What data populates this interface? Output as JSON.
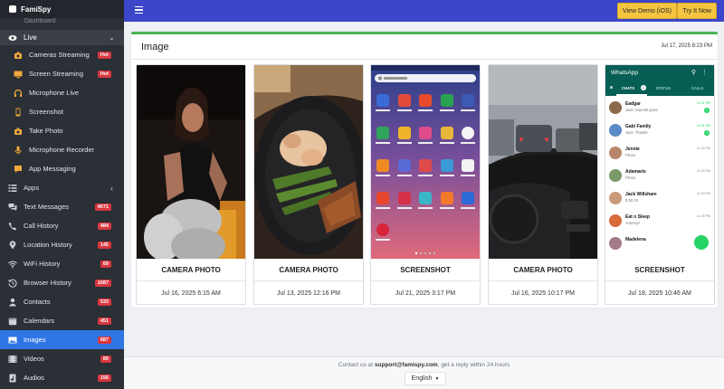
{
  "app": {
    "brand": "FamiSpy"
  },
  "sidebar": {
    "partial_label": "Dashboard",
    "live_group": "Live",
    "live_items": [
      {
        "label": "Cameras Streaming",
        "badge": "Hot"
      },
      {
        "label": "Screen Streaming",
        "badge": "Hot"
      },
      {
        "label": "Microphone Live",
        "badge": ""
      },
      {
        "label": "Screenshot",
        "badge": ""
      },
      {
        "label": "Take Photo",
        "badge": ""
      },
      {
        "label": "Microphone Recorder",
        "badge": ""
      },
      {
        "label": "App Messaging",
        "badge": ""
      }
    ],
    "apps_label": "Apps",
    "items": [
      {
        "label": "Text Messages",
        "badge": "4071"
      },
      {
        "label": "Call History",
        "badge": "484"
      },
      {
        "label": "Location History",
        "badge": "145"
      },
      {
        "label": "WiFi History",
        "badge": "69"
      },
      {
        "label": "Browser History",
        "badge": "1087"
      },
      {
        "label": "Contacts",
        "badge": "533"
      },
      {
        "label": "Calendars",
        "badge": "451"
      },
      {
        "label": "Images",
        "badge": "687"
      },
      {
        "label": "Videos",
        "badge": "89"
      },
      {
        "label": "Audios",
        "badge": "156"
      }
    ]
  },
  "topbar": {
    "view_demo": "View Demo (iOS)",
    "try_now": "Try It Now"
  },
  "card": {
    "title": "Image",
    "date": "Jul 17, 2025 8:23 PM",
    "tiles": [
      {
        "caption": "CAMERA PHOTO",
        "date": "Jul 16, 2025 6:15 AM"
      },
      {
        "caption": "CAMERA PHOTO",
        "date": "Jul 13, 2025 12:16 PM"
      },
      {
        "caption": "SCREENSHOT",
        "date": "Jul 21, 2025 3:17 PM"
      },
      {
        "caption": "CAMERA PHOTO",
        "date": "Jul 16, 2025 10:17 PM"
      },
      {
        "caption": "SCREENSHOT",
        "date": "Jul 18, 2025 10:46 AM"
      }
    ]
  },
  "phone_screenshot": {
    "search": "Search phone",
    "apps": [
      "Samsung",
      "Google",
      "Microsoft Apps",
      "Play Store",
      "Facebook",
      "Phone",
      "Messages",
      "Camera",
      "Gallery",
      "Clock",
      "Contacts",
      "Settings",
      "Calendar",
      "Calculator",
      "Radio",
      "Samsung Notes",
      "Opera Max",
      "USB Backup",
      "UC Browser",
      "Imo",
      "MyJio"
    ]
  },
  "whatsapp": {
    "title": "WhatsApp",
    "tabs": [
      "CHATS",
      "STATUS",
      "CALLS"
    ],
    "chats": [
      {
        "name": "Eadgar",
        "msg": "Jack: Sounds good",
        "time": "11:31 PM",
        "unread": "1"
      },
      {
        "name": "Gabi Family",
        "msg": "Jack: Thanks",
        "time": "11:31 PM",
        "unread": "1"
      },
      {
        "name": "Jennie",
        "msg": "Photo",
        "time": "11:26 PM",
        "unread": ""
      },
      {
        "name": "Adamaris",
        "msg": "Photo",
        "time": "11:25 PM",
        "unread": ""
      },
      {
        "name": "Jack Willshare",
        "msg": "$ 50.00",
        "time": "11:25 PM",
        "unread": ""
      },
      {
        "name": "Eat n Sleep",
        "msg": "Yummy!!",
        "time": "11:25 PM",
        "unread": ""
      },
      {
        "name": "Madelena",
        "msg": "",
        "time": "",
        "unread": ""
      }
    ]
  },
  "footer": {
    "contact_prefix": "Contact us at",
    "email": "support@famispy.com",
    "contact_suffix": ", get a reply within 24 hours",
    "language": "English"
  },
  "colors": {
    "sidebar": "#2b2f36",
    "topbar": "#3c46c8",
    "active": "#2f75e4",
    "accent": "#49b556",
    "badge": "#d9373f",
    "button": "#f5c542",
    "whatsapp": "#075e54"
  },
  "icons": [
    "eye-icon",
    "camera-icon",
    "monitor-icon",
    "headphones-icon",
    "phone-icon",
    "photo-camera-icon",
    "microphone-icon",
    "chat-bubble-icon",
    "apps-icon",
    "messages-icon",
    "call-icon",
    "location-icon",
    "wifi-icon",
    "history-icon",
    "contacts-icon",
    "calendar-icon",
    "images-icon",
    "videos-icon",
    "audios-icon",
    "menu-icon"
  ]
}
